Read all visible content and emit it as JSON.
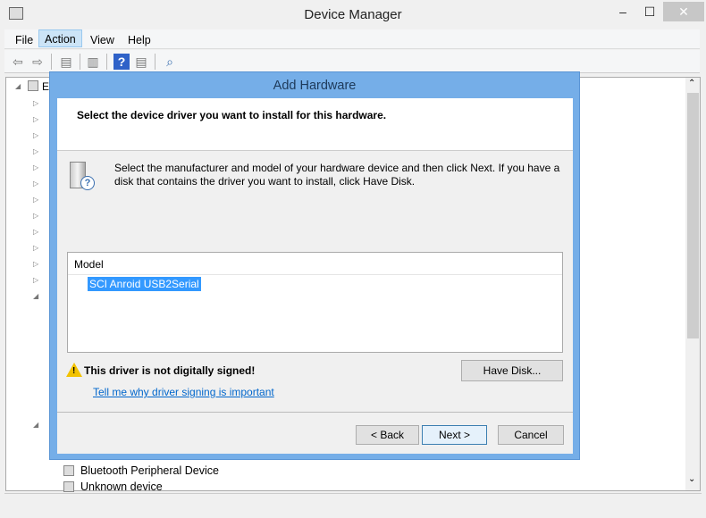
{
  "window": {
    "title": "Device Manager",
    "minimize": "–",
    "maximize": "☐",
    "close": "✕"
  },
  "menu": [
    {
      "label": "File"
    },
    {
      "label": "Action"
    },
    {
      "label": "View"
    },
    {
      "label": "Help"
    }
  ],
  "tree": {
    "root_label": "E",
    "items": [
      {
        "label": "Bluetooth Peripheral Device"
      },
      {
        "label": "Unknown device"
      }
    ]
  },
  "dialog": {
    "title": "Add Hardware",
    "header": "Select the device driver you want to install for this hardware.",
    "description": "Select the manufacturer and model of your hardware device and then click Next. If you have a disk that contains the driver you want to install, click Have Disk.",
    "list_header": "Model",
    "models": [
      "SCI Anroid USB2Serial"
    ],
    "warning": "This driver is not digitally signed!",
    "link": "Tell me why driver signing is important",
    "have_disk": "Have Disk...",
    "back": "< Back",
    "next": "Next >",
    "cancel": "Cancel"
  },
  "colors": {
    "accent": "#75aee8",
    "selection": "#3399ff",
    "link": "#0066cc"
  }
}
